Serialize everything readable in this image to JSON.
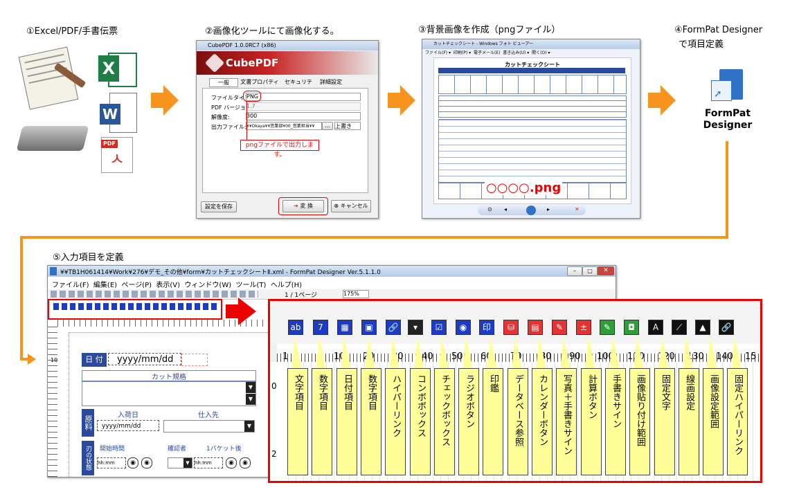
{
  "steps": {
    "s1": "①Excel/PDF/手書伝票",
    "s2": "②画像化ツールにて画像化する。",
    "s3": "③背景画像を作成（pngファイル）",
    "s4_line1": "④FormPat Designer",
    "s4_line2": "で項目定義",
    "s5": "⑤入力項目を定義"
  },
  "cubepdf": {
    "window_title": "CubePDF 1.0.0RC7 (x86)",
    "brand": "CubePDF",
    "tabs": [
      "一般",
      "文書プロパティ",
      "セキュリティ",
      "詳細設定"
    ],
    "labels": [
      "ファイルタイプ:",
      "PDF バージョン:",
      "解像度:",
      "出力ファイル:"
    ],
    "values": [
      "PNG",
      "1.7",
      "300",
      "¥¥Okaya¥¥営業部¥00_営業担当¥¥"
    ],
    "overwrite": "上書き",
    "callout": "pngファイルで出力します。",
    "save_settings": "設定を保存",
    "convert": "変 換",
    "cancel": "キャンセル"
  },
  "photo_viewer": {
    "window_title": "カットチェックシート - Windows フォト ビューアー",
    "menu": [
      "ファイル(F) ▾",
      "印刷(P) ▾",
      "電子メール(E)",
      "書き込み(U) ▾",
      "開く(O) ▾"
    ],
    "sheet_title": "カットチェックシート",
    "png_label": "○○○○.png"
  },
  "formpat": {
    "icon_line1": "FormPat",
    "icon_line2": "Designer"
  },
  "designer": {
    "window_title": "¥¥TB1H061414¥Work¥276¥デモ_その他¥form¥カットチェックシートⅡ.xml - FormPat Designer Ver.5.1.1.0",
    "menu": [
      "ファイル(F)",
      "編集(E)",
      "ページ(P)",
      "表示(V)",
      "ウィンドウ(W)",
      "ツール(T)",
      "ヘルプ(H)"
    ],
    "page_indicator": "1 / 1ページ",
    "zoom": "175%",
    "date_label": "日 付",
    "date_value": "yyyy/mm/dd",
    "cut_label": "カット規格",
    "material_label": "原料",
    "arrival_label": "入荷日",
    "supplier_label": "仕入先",
    "arrival_value": "yyyy/mm/dd",
    "status_label": "刃の状態",
    "start_label": "開始時間",
    "checker_label": "確認者",
    "after_label": "1バケット後",
    "time_value": "hh:mm",
    "ruler": [
      "0",
      "10"
    ]
  },
  "zoom_panel": {
    "ruler": [
      "10",
      "20",
      "30",
      "40",
      "50",
      "60",
      "70",
      "80",
      "90",
      "100",
      "110",
      "120",
      "130",
      "140",
      "15"
    ],
    "items": [
      "文字項目",
      "数字項目",
      "日付項目",
      "数字項目",
      "ハイパーリンク",
      "コンボボックス",
      "チェックボックス",
      "ラジオボタン",
      "印鑑",
      "データベース参照",
      "カレンダーボタン",
      "写真＋手書きサイン",
      "計算ボタン",
      "手書きサイン",
      "画像貼り付け範囲",
      "固定文字",
      "線画設定",
      "画像設定範囲",
      "固定ハイパーリンク"
    ]
  },
  "colors": {
    "orange": "#f7941d",
    "red_frame": "#e00000",
    "callout_fill": "#ffff99",
    "icon_blue": "#1c3cc8",
    "icon_red": "#e53333",
    "icon_green": "#2e9e3a"
  }
}
